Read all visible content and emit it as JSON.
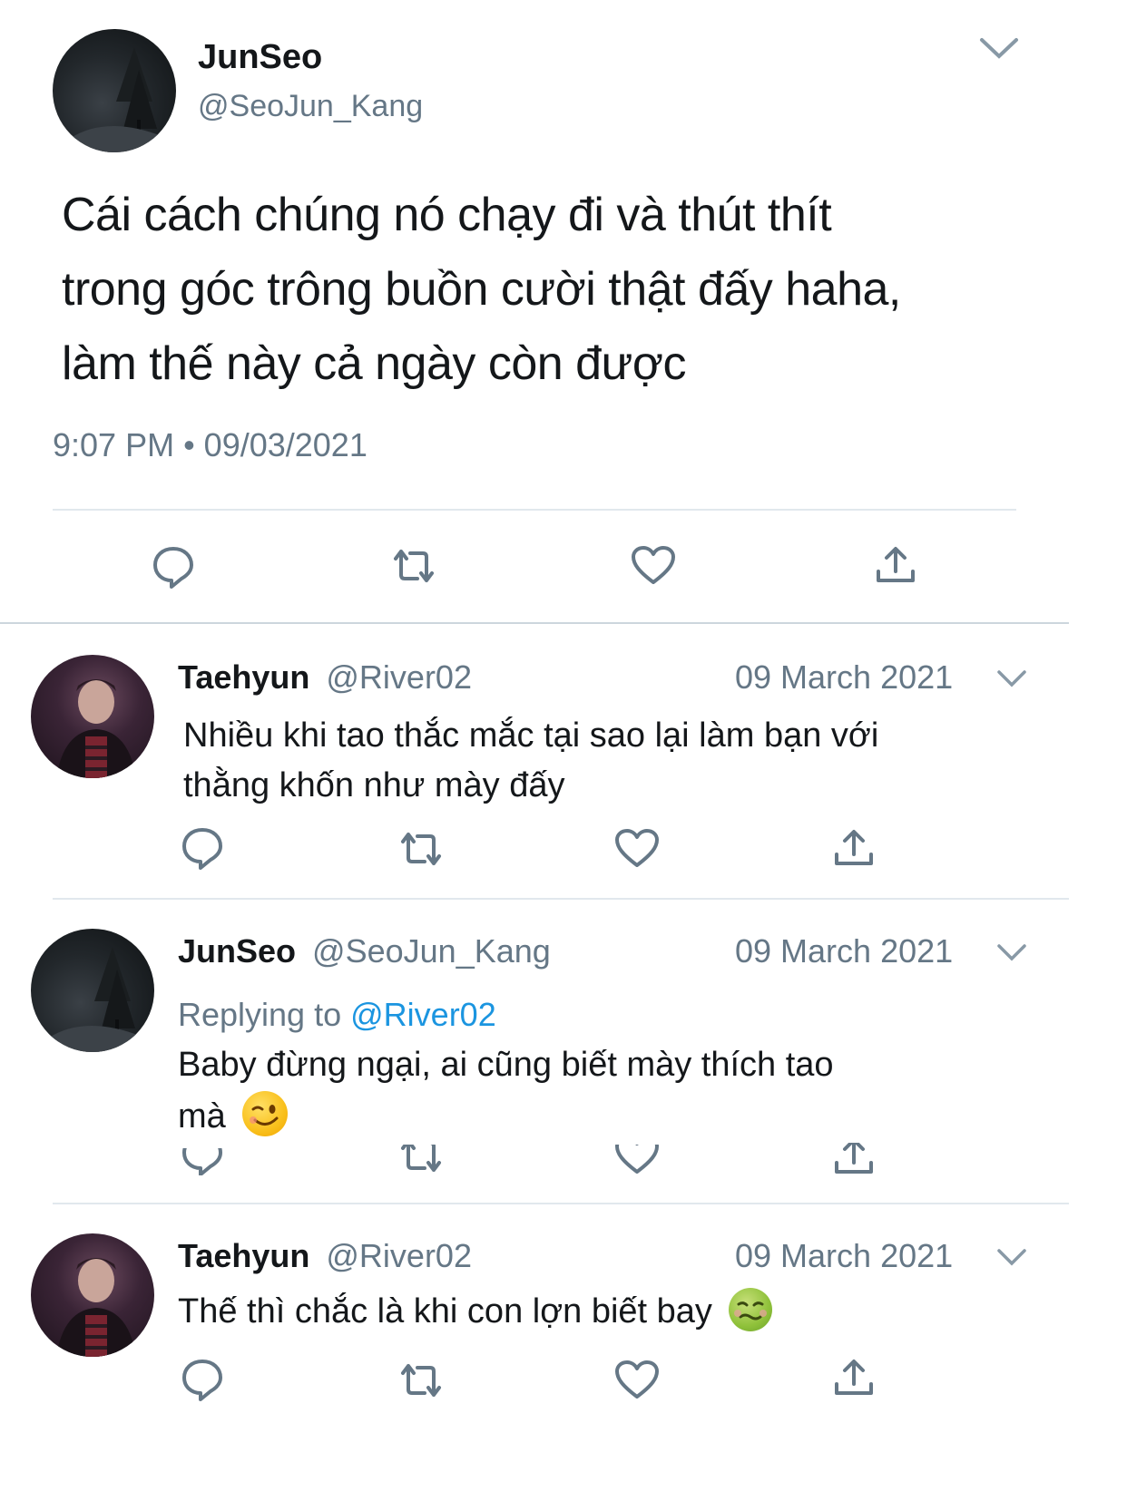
{
  "main_tweet": {
    "display_name": "JunSeo",
    "handle": "@SeoJun_Kang",
    "text_lines": [
      "Cái cách chúng nó chạy đi và thút thít",
      "trong góc trông buồn cười thật đấy haha,",
      "làm thế này cả ngày còn được"
    ],
    "timestamp": "9:07 PM • 09/03/2021",
    "avatar_icon": "forest-night-avatar"
  },
  "replies": [
    {
      "display_name": "Taehyun",
      "handle": "@River02",
      "date": "09 March 2021",
      "lines": [
        "Nhiều khi tao thắc mắc tại sao lại làm bạn với",
        "thằng khốn như mày đấy"
      ]
    },
    {
      "display_name": "JunSeo",
      "handle": "@SeoJun_Kang",
      "date": "09 March 2021",
      "replying_label": "Replying to",
      "replying_handle": "@River02",
      "lines": [
        "Baby đừng ngại, ai cũng biết mày thích tao",
        "mà"
      ],
      "emoji": "winking-face-emoji"
    },
    {
      "display_name": "Taehyun",
      "handle": "@River02",
      "date": "09 March 2021",
      "lines": [
        "Thế thì chắc là khi con lợn biết bay"
      ],
      "emoji": "nauseated-face-emoji"
    }
  ],
  "colors": {
    "text": "#14171a",
    "muted": "#657786",
    "link": "#1b95e0",
    "divider": "#e1e8ed"
  }
}
